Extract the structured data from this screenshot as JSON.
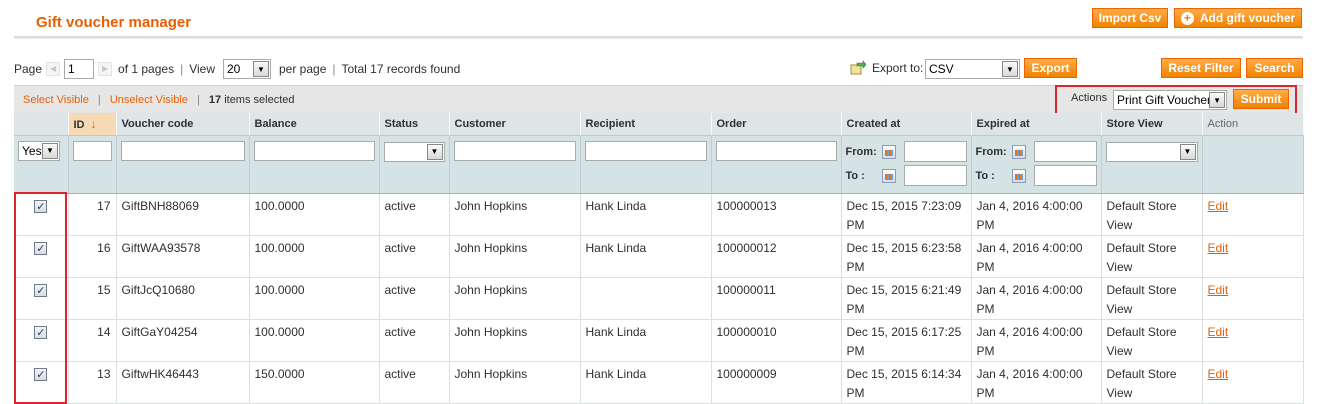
{
  "header": {
    "title": "Gift voucher manager",
    "import_label": "Import Csv",
    "add_label": "Add gift voucher"
  },
  "pager": {
    "page_label": "Page",
    "page_value": "1",
    "of_pages": "of 1 pages",
    "view_label": "View",
    "view_value": "20",
    "per_page": "per page",
    "total": "Total 17 records found"
  },
  "export": {
    "label": "Export to:",
    "format": "CSV",
    "button": "Export"
  },
  "filter_buttons": {
    "reset": "Reset Filter",
    "search": "Search"
  },
  "massaction": {
    "select_visible": "Select Visible",
    "unselect_visible": "Unselect Visible",
    "selected_count": "17",
    "selected_suffix": "items selected",
    "actions_label": "Actions",
    "action_value": "Print Gift Voucher",
    "submit": "Submit"
  },
  "columns": {
    "id": "ID",
    "code": "Voucher code",
    "balance": "Balance",
    "status": "Status",
    "customer": "Customer",
    "recipient": "Recipient",
    "order": "Order",
    "created": "Created at",
    "expired": "Expired at",
    "store": "Store View",
    "action": "Action"
  },
  "filters": {
    "massaction_value": "Yes",
    "from_label": "From:",
    "to_label": "To :"
  },
  "rows": [
    {
      "id": "17",
      "code": "GiftBNH88069",
      "balance": "100.0000",
      "status": "active",
      "customer": "John Hopkins",
      "recipient": "Hank Linda",
      "order": "100000013",
      "created": "Dec 15, 2015 7:23:09 PM",
      "expired": "Jan 4, 2016 4:00:00 PM",
      "store": "Default Store View",
      "action": "Edit"
    },
    {
      "id": "16",
      "code": "GiftWAA93578",
      "balance": "100.0000",
      "status": "active",
      "customer": "John Hopkins",
      "recipient": "Hank Linda",
      "order": "100000012",
      "created": "Dec 15, 2015 6:23:58 PM",
      "expired": "Jan 4, 2016 4:00:00 PM",
      "store": "Default Store View",
      "action": "Edit"
    },
    {
      "id": "15",
      "code": "GiftJcQ10680",
      "balance": "100.0000",
      "status": "active",
      "customer": "John Hopkins",
      "recipient": "",
      "order": "100000011",
      "created": "Dec 15, 2015 6:21:49 PM",
      "expired": "Jan 4, 2016 4:00:00 PM",
      "store": "Default Store View",
      "action": "Edit"
    },
    {
      "id": "14",
      "code": "GiftGaY04254",
      "balance": "100.0000",
      "status": "active",
      "customer": "John Hopkins",
      "recipient": "Hank Linda",
      "order": "100000010",
      "created": "Dec 15, 2015 6:17:25 PM",
      "expired": "Jan 4, 2016 4:00:00 PM",
      "store": "Default Store View",
      "action": "Edit"
    },
    {
      "id": "13",
      "code": "GiftwHK46443",
      "balance": "150.0000",
      "status": "active",
      "customer": "John Hopkins",
      "recipient": "Hank Linda",
      "order": "100000009",
      "created": "Dec 15, 2015 6:14:34 PM",
      "expired": "Jan 4, 2016 4:00:00 PM",
      "store": "Default Store View",
      "action": "Edit"
    }
  ]
}
